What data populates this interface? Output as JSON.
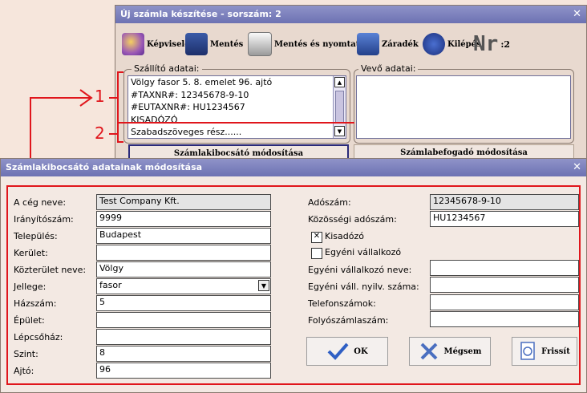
{
  "back_window": {
    "title": "Új számla készítése - sorszám: 2",
    "toolbar": {
      "representative": "Képviselő",
      "save": "Mentés",
      "save_print": "Mentés és nyomtatás",
      "clause": "Záradék",
      "exit": "Kilépés",
      "nr_label": "Nr",
      "nr_value": ":2"
    },
    "supplier_group": "Szállító adatai:",
    "buyer_group": "Vevő adatai:",
    "supplier_lines": [
      "Völgy fasor 5. 8. emelet 96. ajtó",
      "#TAXNR#: 12345678-9-10",
      "#EUTAXNR#: HU1234567",
      "KISADÓZÓ",
      "Szabadszöveges rész......"
    ],
    "modify_issuer": "Számlakibocsátó módosítása",
    "modify_receiver": "Számlabefogadó módosítása",
    "callout_1": "1",
    "callout_2": "2"
  },
  "dialog": {
    "title": "Számlakibocsátó adatainak módosítása",
    "left": {
      "company_name_label": "A cég neve:",
      "company_name": "Test Company Kft.",
      "zip_label": "Irányítószám:",
      "zip": "9999",
      "city_label": "Település:",
      "city": "Budapest",
      "district_label": "Kerület:",
      "district": "",
      "street_label": "Közterület neve:",
      "street": "Völgy",
      "type_label": "Jellege:",
      "type": "fasor",
      "house_label": "Házszám:",
      "house": "5",
      "building_label": "Épület:",
      "building": "",
      "stair_label": "Lépcsőház:",
      "stair": "",
      "floor_label": "Szint:",
      "floor": "8",
      "door_label": "Ajtó:",
      "door": "96"
    },
    "right": {
      "tax_label": "Adószám:",
      "tax": "12345678-9-10",
      "eutax_label": "Közösségi adószám:",
      "eutax": "HU1234567",
      "kisadozo_label": "Kisadózó",
      "kisadozo_checked": true,
      "ev_label": "Egyéni vállalkozó",
      "ev_checked": false,
      "ev_name_label": "Egyéni vállalkozó neve:",
      "ev_name": "",
      "ev_reg_label": "Egyéni váll. nyilv. száma:",
      "ev_reg": "",
      "phone_label": "Telefonszámok:",
      "phone": "",
      "account_label": "Folyószámlaszám:",
      "account": ""
    },
    "buttons": {
      "ok": "OK",
      "cancel": "Mégsem",
      "refresh": "Frissít"
    }
  },
  "colors": {
    "titlebar": "#7478b8",
    "annotation": "#e0161c"
  }
}
